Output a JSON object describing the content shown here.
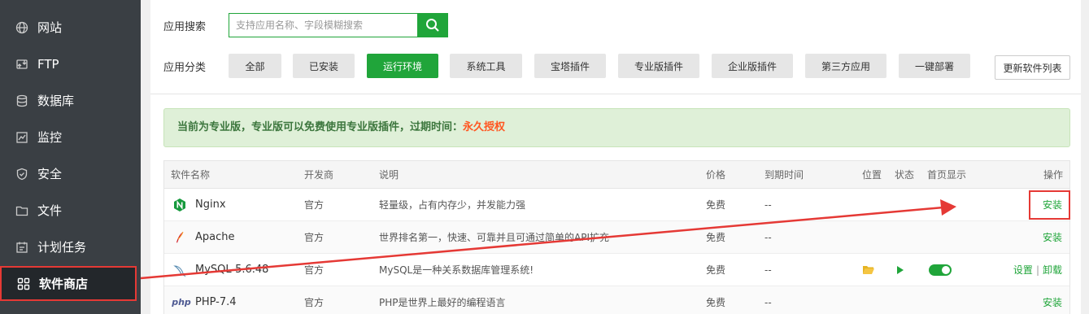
{
  "sidebar": {
    "items": [
      {
        "label": "网站",
        "icon": "globe-icon"
      },
      {
        "label": "FTP",
        "icon": "ftp-icon"
      },
      {
        "label": "数据库",
        "icon": "database-icon"
      },
      {
        "label": "监控",
        "icon": "monitor-icon"
      },
      {
        "label": "安全",
        "icon": "shield-icon"
      },
      {
        "label": "文件",
        "icon": "folder-icon"
      },
      {
        "label": "计划任务",
        "icon": "calendar-icon"
      },
      {
        "label": "软件商店",
        "icon": "grid-icon",
        "active": true
      }
    ]
  },
  "search": {
    "label": "应用搜索",
    "placeholder": "支持应用名称、字段模糊搜索"
  },
  "categories": {
    "label": "应用分类",
    "items": [
      "全部",
      "已安装",
      "运行环境",
      "系统工具",
      "宝塔插件",
      "专业版插件",
      "企业版插件",
      "第三方应用",
      "一键部署"
    ],
    "active": "运行环境",
    "refresh_label": "更新软件列表"
  },
  "notice": {
    "text": "当前为专业版，专业版可以免费使用专业版插件，过期时间：",
    "highlight": "永久授权"
  },
  "table": {
    "headers": {
      "name": "软件名称",
      "developer": "开发商",
      "desc": "说明",
      "price": "价格",
      "expire": "到期时间",
      "location": "位置",
      "status": "状态",
      "homepage": "首页显示",
      "ops": "操作"
    },
    "rows": [
      {
        "name": "Nginx",
        "icon": "nginx-icon",
        "developer": "官方",
        "desc": "轻量级，占有内存少，并发能力强",
        "price": "免费",
        "expire": "--",
        "action": "安装"
      },
      {
        "name": "Apache",
        "icon": "apache-feather-icon",
        "developer": "官方",
        "desc": "世界排名第一，快速、可靠并且可通过简单的API扩充",
        "price": "免费",
        "expire": "--",
        "action": "安装"
      },
      {
        "name": "MySQL-5.6.48",
        "icon": "mysql-dolphin-icon",
        "developer": "官方",
        "desc": "MySQL是一种关系数据库管理系统!",
        "price": "免费",
        "expire": "--",
        "action_settings": "设置",
        "action_uninstall": "卸载",
        "sep": "|"
      },
      {
        "name": "PHP-7.4",
        "icon": "php-icon",
        "developer": "官方",
        "desc": "PHP是世界上最好的编程语言",
        "price": "免费",
        "expire": "--",
        "action": "安装"
      }
    ]
  },
  "colors": {
    "accent": "#20a53a",
    "sidebar_bg": "#3a3f44",
    "highlight_red": "#e53935",
    "notice_bg": "#dff0d8",
    "perm_orange": "#ff5722"
  }
}
